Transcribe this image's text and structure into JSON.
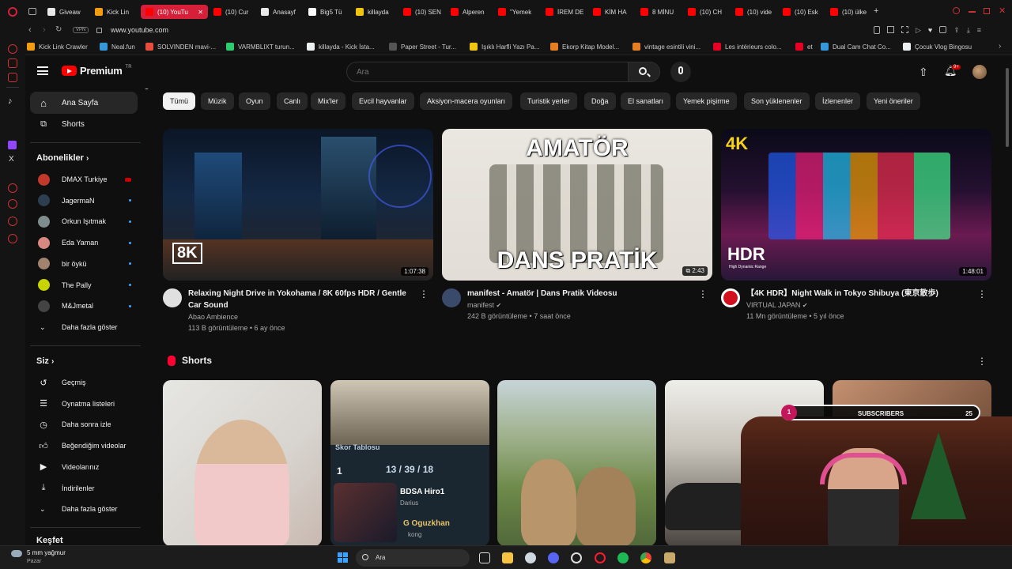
{
  "browser": {
    "tabs": [
      {
        "label": "Giveaw",
        "color": "#e8e8e8"
      },
      {
        "label": "Kick Lin",
        "color": "#f39c12"
      },
      {
        "label": "(10) YouTu",
        "color": "#ff0000",
        "active": true
      },
      {
        "label": "(10) Cur",
        "color": "#ff0000"
      },
      {
        "label": "Anasayf",
        "color": "#e8e8e8"
      },
      {
        "label": "Big5 Tü",
        "color": "#ffffff"
      },
      {
        "label": "killayda",
        "color": "#f1c40f"
      },
      {
        "label": "(10) SEN",
        "color": "#ff0000"
      },
      {
        "label": "Alperen",
        "color": "#ff0000"
      },
      {
        "label": "''Yemek",
        "color": "#ff0000"
      },
      {
        "label": "İREM DE",
        "color": "#ff0000"
      },
      {
        "label": "KİM HA",
        "color": "#ff0000"
      },
      {
        "label": "8 MİNU",
        "color": "#ff0000"
      },
      {
        "label": "(10) CH",
        "color": "#ff0000"
      },
      {
        "label": "(10) vide",
        "color": "#ff0000"
      },
      {
        "label": "(10) Esk",
        "color": "#ff0000"
      },
      {
        "label": "(10) ülke",
        "color": "#ff0000"
      }
    ],
    "vpn": "VPN",
    "url": "www.youtube.com",
    "bookmarks": [
      {
        "label": "Kick Link Crawler",
        "color": "#f39c12"
      },
      {
        "label": "Neal.fun",
        "color": "#3498db"
      },
      {
        "label": "SOLVINDEN mavi-...",
        "color": "#e74c3c"
      },
      {
        "label": "VARMBLIXT turun...",
        "color": "#2ecc71"
      },
      {
        "label": "killayda - Kick İsta...",
        "color": "#ecf0f1"
      },
      {
        "label": "Paper Street - Tur...",
        "color": "#555555"
      },
      {
        "label": "Işıklı Harfli Yazı Pa...",
        "color": "#f1c40f"
      },
      {
        "label": "Ekorp Kitap Model...",
        "color": "#e67e22"
      },
      {
        "label": "vintage esintili vini...",
        "color": "#e67e22"
      },
      {
        "label": "Les intérieurs colo...",
        "color": "#e60023"
      },
      {
        "label": "et",
        "color": "#e60023"
      },
      {
        "label": "Dual Cam Chat Co...",
        "color": "#3498db"
      },
      {
        "label": "Çocuk Vlog Bingosu",
        "color": "#ecf0f1"
      }
    ]
  },
  "youtube": {
    "logo_text": "Premium",
    "logo_sup": "TR",
    "search_placeholder": "Ara",
    "notif_badge": "9+",
    "sidebar": {
      "main": [
        {
          "label": "Ana Sayfa",
          "icon": "home-icon"
        },
        {
          "label": "Shorts",
          "icon": "shorts-icon"
        }
      ],
      "subs_title": "Abonelikler",
      "subs": [
        {
          "label": "DMAX Turkiye",
          "color": "#c0392b",
          "live": true
        },
        {
          "label": "JagermaN",
          "color": "#2c3e50"
        },
        {
          "label": "Orkun Işıtmak",
          "color": "#7f8c8d"
        },
        {
          "label": "Eda Yaman",
          "color": "#d98880"
        },
        {
          "label": "bir öykü",
          "color": "#a0826d"
        },
        {
          "label": "The Pally",
          "color": "#c8d400"
        },
        {
          "label": "M&Jmetal",
          "color": "#444444"
        }
      ],
      "subs_more": "Daha fazla göster",
      "you_title": "Siz",
      "you": [
        {
          "label": "Geçmiş",
          "icon": "history-icon"
        },
        {
          "label": "Oynatma listeleri",
          "icon": "playlist-icon"
        },
        {
          "label": "Daha sonra izle",
          "icon": "clock-icon"
        },
        {
          "label": "Beğendiğim videolar",
          "icon": "like-icon"
        },
        {
          "label": "Videolarınız",
          "icon": "video-icon"
        },
        {
          "label": "İndirilenler",
          "icon": "download-icon"
        }
      ],
      "you_more": "Daha fazla göster",
      "explore": "Keşfet"
    },
    "chips": [
      "Tümü",
      "Müzik",
      "Oyun",
      "Canlı",
      "Mix'ler",
      "Evcil hayvanlar",
      "Aksiyon-macera oyunları",
      "Turistik yerler",
      "Doğa",
      "El sanatları",
      "Yemek pişirme",
      "Son yüklenenler",
      "İzlenenler",
      "Yeni öneriler"
    ],
    "videos": [
      {
        "title": "Relaxing Night Drive in Yokohama / 8K 60fps HDR / Gentle Car Sound",
        "channel": "Abao Ambience",
        "verified": false,
        "meta": "113 B görüntüleme • 6 ay önce",
        "duration": "1:07:38",
        "overlay": "8K"
      },
      {
        "title": "manifest - Amatör | Dans Pratik Videosu",
        "channel": "manifest",
        "verified": true,
        "meta": "242 B görüntüleme • 7 saat önce",
        "duration": "2:43",
        "overlay_top": "AMATÖR",
        "overlay_bottom": "DANS PRATİK"
      },
      {
        "title": "【4K HDR】Night Walk in Tokyo Shibuya (東京散歩)",
        "channel": "VIRTUAL JAPAN",
        "verified": true,
        "meta": "11 Mn görüntüleme • 5 yıl önce",
        "duration": "1:48:01",
        "overlay_top": "4K",
        "overlay": "HDR",
        "overlay_sub": "High Dynamic Range"
      }
    ],
    "shorts_title": "Shorts",
    "shorts_overlay": {
      "game_title": "Skor Tablosu",
      "score": "13 / 39 / 18",
      "player1": "BDSA Hiro1",
      "champ1": "Darius",
      "player2": "G Oguzkhan",
      "champ2": "kong",
      "level": "1"
    }
  },
  "stream_overlay": {
    "label": "SUBSCRIBERS",
    "current": "1",
    "goal": "25"
  },
  "taskbar": {
    "weather": "5 mm yağmur",
    "weather_day": "Pazar",
    "search": "Ara"
  }
}
